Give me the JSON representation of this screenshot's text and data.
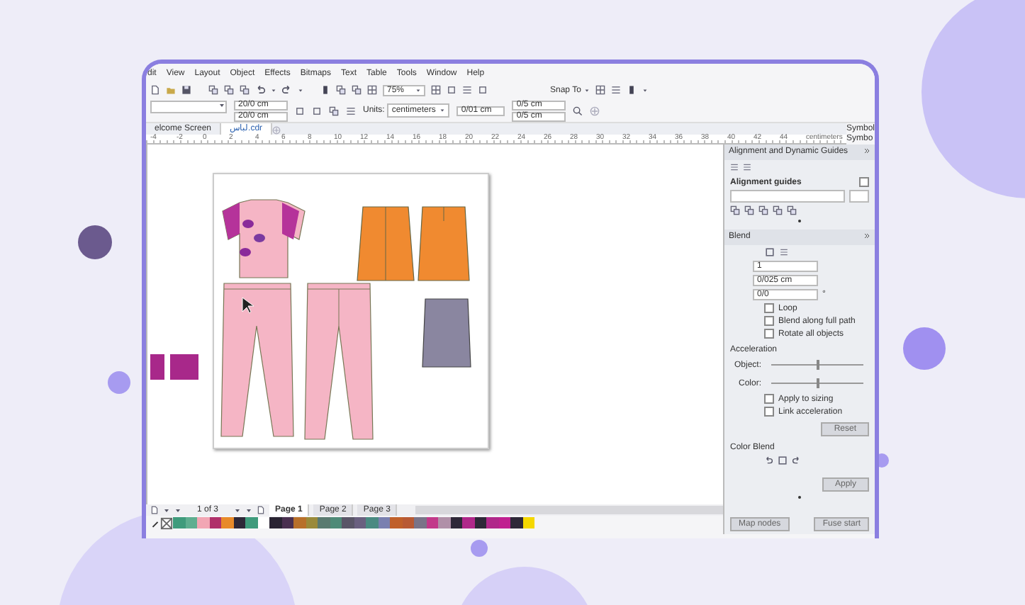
{
  "menu": [
    {
      "label": "dit"
    },
    {
      "label": "View"
    },
    {
      "label": "Layout"
    },
    {
      "label": "Object"
    },
    {
      "label": "Effects"
    },
    {
      "label": "Bitmaps"
    },
    {
      "label": "Text"
    },
    {
      "label": "Table"
    },
    {
      "label": "Tools"
    },
    {
      "label": "Window"
    },
    {
      "label": "Help"
    }
  ],
  "toolbar": {
    "zoom": "75%",
    "snap": "Snap To"
  },
  "property_bar": {
    "width": "20/0 cm",
    "height": "20/0 cm",
    "units_label": "Units:",
    "units": "centimeters",
    "nudge": "0/01 cm",
    "duplicate_x": "0/5 cm",
    "duplicate_y": "0/5 cm"
  },
  "document_tabs": [
    {
      "label": "elcome Screen",
      "selected": false
    },
    {
      "label": "لباس.cdr",
      "selected": true
    }
  ],
  "side_tabs": [
    "Symbol",
    "Symbo"
  ],
  "ruler": {
    "ticks": [
      "-4",
      "-2",
      "0",
      "2",
      "4",
      "6",
      "8",
      "10",
      "12",
      "14",
      "16",
      "18",
      "20",
      "22",
      "24",
      "26",
      "28",
      "30",
      "32",
      "34",
      "36",
      "38",
      "40",
      "42",
      "44"
    ],
    "unit": "centimeters"
  },
  "docker": {
    "guides_title": "Alignment and Dynamic Guides",
    "guides_section": "Alignment guides",
    "guides_checked": false,
    "blend_title": "Blend",
    "steps": "1",
    "spacing": "0/025 cm",
    "rotation": "0/0",
    "rotation_unit": "°",
    "options": [
      {
        "label": "Loop",
        "checked": false
      },
      {
        "label": "Blend along full path",
        "checked": false
      },
      {
        "label": "Rotate all objects",
        "checked": false
      }
    ],
    "acceleration_title": "Acceleration",
    "sliders": [
      {
        "label": "Object:",
        "level": 0.5
      },
      {
        "label": "Color:",
        "level": 0.5
      }
    ],
    "acceleration_options": [
      {
        "label": "Apply to sizing",
        "checked": false
      },
      {
        "label": "Link acceleration",
        "checked": false
      }
    ],
    "reset": "Reset",
    "color_blend_title": "Color Blend",
    "apply": "Apply",
    "bottom_buttons": [
      "Map nodes",
      "Fuse start"
    ]
  },
  "page_nav": {
    "counter": "1 of 3",
    "pages": [
      {
        "label": "Page 1",
        "selected": true
      },
      {
        "label": "Page 2",
        "selected": false
      },
      {
        "label": "Page 3",
        "selected": false
      }
    ]
  },
  "palette": [
    {
      "color": "#3f9b7c"
    },
    {
      "color": "#5fae90"
    },
    {
      "color": "#f2a6b4"
    },
    {
      "color": "#b0306a"
    },
    {
      "color": "#e88a2a"
    },
    {
      "color": "#2e2838"
    },
    {
      "color": "#3f9b7c"
    },
    {
      "color": "#ffffff"
    },
    {
      "color": "#2a2433"
    },
    {
      "color": "#4a3050"
    },
    {
      "color": "#b8702a"
    },
    {
      "color": "#9a8a3a"
    },
    {
      "color": "#5a7a70"
    },
    {
      "color": "#4f8a78"
    },
    {
      "color": "#5a5668"
    },
    {
      "color": "#6a6080"
    },
    {
      "color": "#4a8a82"
    },
    {
      "color": "#7a80b0"
    },
    {
      "color": "#c0602a"
    },
    {
      "color": "#b85a34"
    },
    {
      "color": "#7a7488"
    },
    {
      "color": "#c23a8a"
    },
    {
      "color": "#b090a8"
    },
    {
      "color": "#2e2838"
    },
    {
      "color": "#b0288a"
    },
    {
      "color": "#2e2838"
    },
    {
      "color": "#b0288a"
    },
    {
      "color": "#c02090"
    },
    {
      "color": "#2e2838"
    },
    {
      "color": "#f5d800"
    }
  ]
}
